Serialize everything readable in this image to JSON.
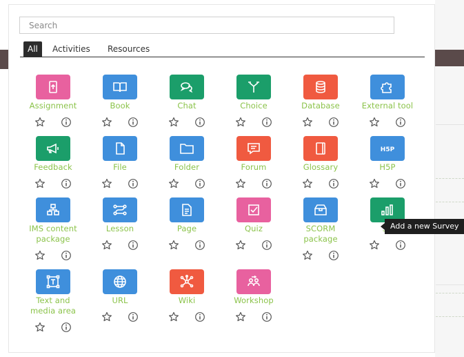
{
  "search": {
    "placeholder": "Search"
  },
  "tabs": [
    {
      "label": "All"
    },
    {
      "label": "Activities"
    },
    {
      "label": "Resources"
    }
  ],
  "tooltip": {
    "text": "Add a new Survey"
  },
  "modules": [
    {
      "name_lines": [
        "Assignment"
      ],
      "color": "#e8619f",
      "icon": "assignment-icon"
    },
    {
      "name_lines": [
        "Book"
      ],
      "color": "#3f8fdc",
      "icon": "book-icon"
    },
    {
      "name_lines": [
        "Chat"
      ],
      "color": "#1b9e6a",
      "icon": "chat-icon"
    },
    {
      "name_lines": [
        "Choice"
      ],
      "color": "#1b9e6a",
      "icon": "choice-icon"
    },
    {
      "name_lines": [
        "Database"
      ],
      "color": "#f05a40",
      "icon": "database-icon"
    },
    {
      "name_lines": [
        "External tool"
      ],
      "color": "#3f8fdc",
      "icon": "puzzle-icon"
    },
    {
      "name_lines": [
        "Feedback"
      ],
      "color": "#1b9e6a",
      "icon": "megaphone-icon"
    },
    {
      "name_lines": [
        "File"
      ],
      "color": "#3f8fdc",
      "icon": "file-icon"
    },
    {
      "name_lines": [
        "Folder"
      ],
      "color": "#3f8fdc",
      "icon": "folder-icon"
    },
    {
      "name_lines": [
        "Forum"
      ],
      "color": "#f05a40",
      "icon": "forum-icon"
    },
    {
      "name_lines": [
        "Glossary"
      ],
      "color": "#f05a40",
      "icon": "glossary-icon"
    },
    {
      "name_lines": [
        "H5P"
      ],
      "color": "#3f8fdc",
      "icon": "h5p-icon",
      "icon_text": "H5P"
    },
    {
      "name_lines": [
        "IMS content",
        "package"
      ],
      "color": "#3f8fdc",
      "icon": "ims-package-icon"
    },
    {
      "name_lines": [
        "Lesson"
      ],
      "color": "#3f8fdc",
      "icon": "lesson-icon"
    },
    {
      "name_lines": [
        "Page"
      ],
      "color": "#3f8fdc",
      "icon": "page-icon"
    },
    {
      "name_lines": [
        "Quiz"
      ],
      "color": "#e8619f",
      "icon": "quiz-icon"
    },
    {
      "name_lines": [
        "SCORM",
        "package"
      ],
      "color": "#3f8fdc",
      "icon": "scorm-icon"
    },
    {
      "name_lines": [
        "Su"
      ],
      "color": "#1b9e6a",
      "icon": "survey-icon"
    },
    {
      "name_lines": [
        "Text and",
        "media area"
      ],
      "color": "#3f8fdc",
      "icon": "text-media-icon"
    },
    {
      "name_lines": [
        "URL"
      ],
      "color": "#3f8fdc",
      "icon": "url-icon"
    },
    {
      "name_lines": [
        "Wiki"
      ],
      "color": "#f05a40",
      "icon": "wiki-icon"
    },
    {
      "name_lines": [
        "Workshop"
      ],
      "color": "#e8619f",
      "icon": "workshop-icon"
    }
  ]
}
